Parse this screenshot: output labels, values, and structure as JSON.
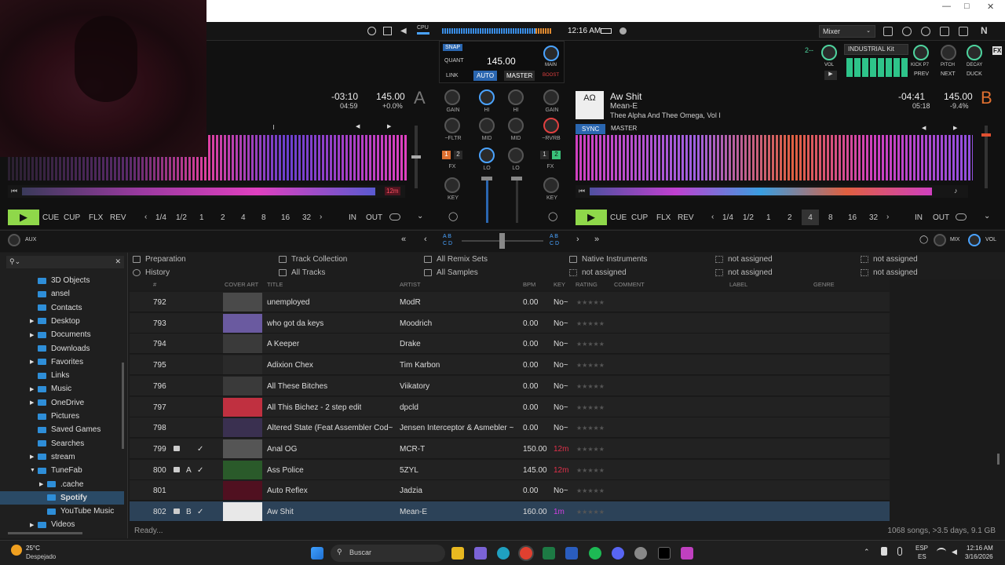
{
  "window": {
    "title": ""
  },
  "topbar": {
    "cpu_label": "CPU",
    "clock": "12:16 AM",
    "view_select": "Mixer"
  },
  "master": {
    "snap": "SNAP",
    "quant": "QUANT",
    "bpm": "145.00",
    "link": "LINK",
    "auto": "AUTO",
    "master": "MASTER",
    "main": "MAIN",
    "boost": "BOOST"
  },
  "fx_unit": {
    "unit_number": "2--",
    "kit": "INDUSTRIAL Kit",
    "vol": "VOL",
    "kick": "KICK P7",
    "pitch": "PITCH",
    "decay": "DECAY",
    "prev": "PREV",
    "next": "NEXT",
    "duck": "DUCK",
    "fx": "FX"
  },
  "deck_a": {
    "letter": "A",
    "remaining": "-03:10",
    "elapsed": "04:59",
    "bpm": "145.00",
    "pitch": "+0.0%",
    "loop_marker": "12m",
    "buttons": {
      "cue": "CUE",
      "cup": "CUP",
      "flx": "FLX",
      "rev": "REV",
      "in": "IN",
      "out": "OUT"
    },
    "loop_sizes": [
      "1/4",
      "1/2",
      "1",
      "2",
      "4",
      "8",
      "16",
      "32"
    ]
  },
  "deck_b": {
    "letter": "B",
    "title": "Aw Shit",
    "artist": "Mean-E",
    "album": "Thee Alpha And Thee Omega, Vol I",
    "remaining": "-04:41",
    "elapsed": "05:18",
    "bpm": "145.00",
    "pitch": "-9.4%",
    "sync": "SYNC",
    "master": "MASTER",
    "buttons": {
      "cue": "CUE",
      "cup": "CUP",
      "flx": "FLX",
      "rev": "REV",
      "in": "IN",
      "out": "OUT"
    },
    "loop_sizes": [
      "1/4",
      "1/2",
      "1",
      "2",
      "4",
      "8",
      "16",
      "32"
    ]
  },
  "mixer": {
    "gain": "GAIN",
    "hi": "HI",
    "mid": "MID",
    "lo": "LO",
    "key": "KEY",
    "fx": "FX",
    "fltr": "~FLTR",
    "rvrb": "~RVRB",
    "fx_a": [
      "1",
      "2"
    ],
    "fx_b": [
      "1",
      "2"
    ]
  },
  "crossfader": {
    "aux": "AUX",
    "left_labels": [
      "A",
      "B",
      "C",
      "D"
    ],
    "right_labels": [
      "A",
      "B",
      "C",
      "D"
    ],
    "mix": "MIX",
    "vol": "VOL"
  },
  "favorites": [
    [
      "Preparation",
      "Track Collection",
      "All Remix Sets",
      "Native Instruments",
      "not assigned",
      "not assigned"
    ],
    [
      "History",
      "All Tracks",
      "All Samples",
      "not assigned",
      "not assigned",
      "not assigned"
    ]
  ],
  "tree": [
    {
      "label": "3D Objects",
      "arrow": false,
      "indent": 0
    },
    {
      "label": "ansel",
      "arrow": false,
      "indent": 0
    },
    {
      "label": "Contacts",
      "arrow": false,
      "indent": 0
    },
    {
      "label": "Desktop",
      "arrow": true,
      "indent": 0
    },
    {
      "label": "Documents",
      "arrow": true,
      "indent": 0
    },
    {
      "label": "Downloads",
      "arrow": false,
      "indent": 0
    },
    {
      "label": "Favorites",
      "arrow": true,
      "indent": 0
    },
    {
      "label": "Links",
      "arrow": false,
      "indent": 0
    },
    {
      "label": "Music",
      "arrow": true,
      "indent": 0
    },
    {
      "label": "OneDrive",
      "arrow": true,
      "indent": 0
    },
    {
      "label": "Pictures",
      "arrow": false,
      "indent": 0
    },
    {
      "label": "Saved Games",
      "arrow": false,
      "indent": 0
    },
    {
      "label": "Searches",
      "arrow": false,
      "indent": 0
    },
    {
      "label": "stream",
      "arrow": true,
      "indent": 0
    },
    {
      "label": "TuneFab",
      "arrow": true,
      "indent": 0,
      "open": true
    },
    {
      "label": ".cache",
      "arrow": true,
      "indent": 1
    },
    {
      "label": "Spotify",
      "arrow": false,
      "indent": 1,
      "selected": true
    },
    {
      "label": "YouTube Music",
      "arrow": false,
      "indent": 1
    },
    {
      "label": "Videos",
      "arrow": true,
      "indent": 0
    }
  ],
  "columns": {
    "num": "#",
    "cover": "COVER ART",
    "title": "TITLE",
    "artist": "ARTIST",
    "bpm": "BPM",
    "key": "KEY",
    "rating": "RATING",
    "comment": "COMMENT",
    "label": "LABEL",
    "genre": "GENRE"
  },
  "tracks": [
    {
      "num": "792",
      "title": "unemployed",
      "artist": "ModR",
      "bpm": "0.00",
      "key": "No~",
      "deck": "",
      "check": false,
      "lock": false
    },
    {
      "num": "793",
      "title": "who got da keys",
      "artist": "Moodrich",
      "bpm": "0.00",
      "key": "No~",
      "deck": "",
      "check": false,
      "lock": false
    },
    {
      "num": "794",
      "title": "A Keeper",
      "artist": "Drake",
      "bpm": "0.00",
      "key": "No~",
      "deck": "",
      "check": false,
      "lock": false
    },
    {
      "num": "795",
      "title": "Adixion Chex",
      "artist": "Tim Karbon",
      "bpm": "0.00",
      "key": "No~",
      "deck": "",
      "check": false,
      "lock": false
    },
    {
      "num": "796",
      "title": "All These Bitches",
      "artist": "Viikatory",
      "bpm": "0.00",
      "key": "No~",
      "deck": "",
      "check": false,
      "lock": false
    },
    {
      "num": "797",
      "title": "All This Bichez - 2 step edit",
      "artist": "dpcld",
      "bpm": "0.00",
      "key": "No~",
      "deck": "",
      "check": false,
      "lock": false
    },
    {
      "num": "798",
      "title": "Altered State (Feat Assembler Cod~",
      "artist": "Jensen Interceptor & Asmebler ~",
      "bpm": "0.00",
      "key": "No~",
      "deck": "",
      "check": false,
      "lock": false
    },
    {
      "num": "799",
      "title": "Anal OG",
      "artist": "MCR-T",
      "bpm": "150.00",
      "key": "12m",
      "deck": "",
      "check": true,
      "lock": true
    },
    {
      "num": "800",
      "title": "Ass Police",
      "artist": "5ZYL",
      "bpm": "145.00",
      "key": "12m",
      "deck": "A",
      "check": true,
      "lock": true
    },
    {
      "num": "801",
      "title": "Auto Reflex",
      "artist": "Jadzia",
      "bpm": "0.00",
      "key": "No~",
      "deck": "",
      "check": false,
      "lock": false
    },
    {
      "num": "802",
      "title": "Aw Shit",
      "artist": "Mean-E",
      "bpm": "160.00",
      "key": "1m",
      "deck": "B",
      "check": true,
      "lock": true,
      "selected": true
    }
  ],
  "status": {
    "left": "Ready...",
    "right": "1068 songs, >3.5 days, 9.1 GB"
  },
  "taskbar": {
    "temp": "25°C",
    "weather": "Despejado",
    "search": "Buscar",
    "lang1": "ESP",
    "lang2": "ES",
    "time": "12:16 AM",
    "date": "3/16/2026"
  },
  "colors": {
    "accent_blue": "#4aa3ff",
    "deck_a": "#8fd84a",
    "red": "#e04040",
    "key_red": "#e0304a",
    "key_magenta": "#d040e0"
  }
}
